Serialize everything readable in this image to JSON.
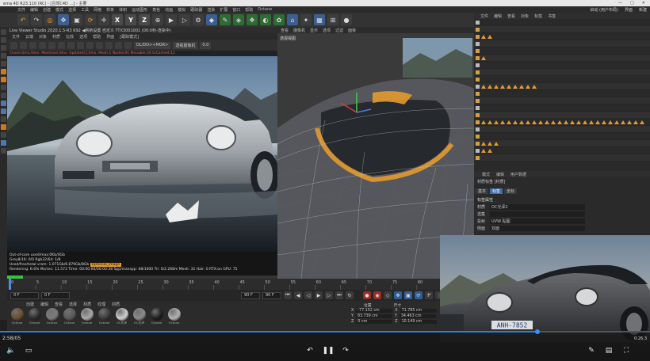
{
  "window": {
    "title": "ema 4D R23.110 (RC) - [吕驾C4D …] - 主要",
    "controls": [
      "—",
      "□",
      "✕"
    ]
  },
  "menubar": [
    "文件",
    "编辑",
    "创建",
    "模式",
    "选择",
    "工具",
    "网格",
    "样条",
    "体积",
    "运动图形",
    "角色",
    "动画",
    "模拟",
    "跟踪器",
    "渲染",
    "扩展",
    "窗口",
    "帮助",
    "Octane"
  ],
  "toolbar": {
    "axes": [
      "X",
      "Y",
      "Z"
    ]
  },
  "live_viewer": {
    "title": "Live Viewer Studio 2020.1.5-R3   K92   ◀刷新设置   自定义   TTX3001001   (00:0秒-渲染中)",
    "menu": [
      "文件",
      "云端",
      "对象",
      "材质",
      "比较",
      "选项",
      "帮助",
      "界面",
      "[跟踪模式]"
    ],
    "mode_select": "DL/DO>+MGR>",
    "camera_select": "透视摄像机",
    "zoom_value": "0.0",
    "status": "Check:0ms./0ms. MeshGen:0ms. Update[C]:0ms. Mesh:1 Nodes:91 Movable:20 txCached:11",
    "info_lines": [
      "Out-of-core used/max:0Kb/4Gb",
      "Grey8/16: 0/0        Rgb32/64: 1/8",
      "Used/free/total vram: 1.071Gb/6.879Gb/8Gb"
    ],
    "info_highlight": "Optional_Image",
    "render_stats": "Rendering: 6.6%   Ms/sec: 11.573   Time: 00:00:00/00:00:38   Spp/maxspp: 68/1000   Tri: 0/2.268m   Mesh: 31   Hair: 0   RTX:on   GPU: 75"
  },
  "viewport": {
    "menu": [
      "查看",
      "摄像机",
      "显示",
      "选项",
      "过滤",
      "面板"
    ],
    "label": "透视视图"
  },
  "timeline": {
    "ticks": [
      "0",
      "5",
      "10",
      "15",
      "20",
      "25",
      "30",
      "35",
      "40",
      "45",
      "50",
      "55",
      "60",
      "65",
      "70",
      "75",
      "80",
      "85",
      "90"
    ],
    "current_frame": "0 F",
    "start_frame": "0 F",
    "end_frame": "90 F",
    "max_frame": "90 F"
  },
  "material_manager": {
    "menu": [
      "创建",
      "编辑",
      "查看",
      "选择",
      "材质",
      "纹理",
      "材质"
    ],
    "materials": [
      "Octane",
      "Octane",
      "Octane",
      "Octane",
      "Octane",
      "Octane",
      "OC光泽",
      "OC光泽",
      "Octane",
      "Octane"
    ],
    "ball_colors": [
      "#6a4d2e",
      "#2c2c2c",
      "#7a7a7a",
      "#5a5a5a",
      "#a8a8a8",
      "#3b3b3b",
      "#cfcfcf",
      "#8a8a8a",
      "#1f1f1f",
      "#b3b3b3"
    ]
  },
  "coordinates": {
    "headers": [
      "位置",
      "尺寸"
    ],
    "rows": [
      {
        "axis": "X",
        "pos": "-77.152 cm",
        "size_axis": "X",
        "size": "71.785 cm"
      },
      {
        "axis": "Y",
        "pos": "83.739 cm",
        "size_axis": "Y",
        "size": "34.463 cm"
      },
      {
        "axis": "Z",
        "pos": "0 cm",
        "size_axis": "Z",
        "size": "10.149 cm"
      }
    ]
  },
  "object_manager": {
    "menu": [
      "文件",
      "编辑",
      "查看",
      "对象",
      "标签",
      "书签"
    ]
  },
  "attribute_manager": {
    "menu": [
      "模式",
      "编辑",
      "用户数据"
    ],
    "object_label": "材质标签 [材质]",
    "tabs": [
      "基本",
      "标签",
      "坐标"
    ],
    "section": "标签属性",
    "rows": [
      {
        "label": "材质",
        "value": "OC光泽2"
      },
      {
        "label": "选集",
        "value": ""
      },
      {
        "label": "投射",
        "value": "UVW 贴图"
      },
      {
        "label": "侧面",
        "value": "双面"
      }
    ]
  },
  "layout_preset": "启动 (用户布局)",
  "top_right_tabs": [
    "界面",
    "新建"
  ],
  "plate_text": "ANH-7852",
  "player": {
    "time": "2:58/05",
    "progress": 0.825,
    "volume_icon": "volume-icon",
    "right_time": "0:26.3"
  }
}
